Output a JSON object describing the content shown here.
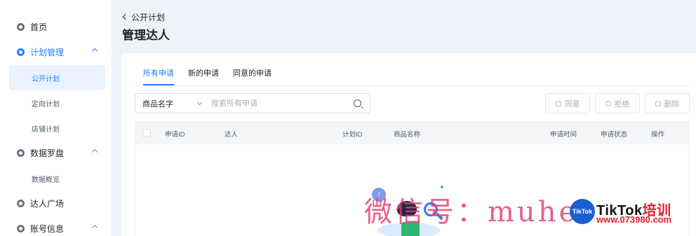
{
  "sidebar": {
    "home": "首页",
    "plan_management": {
      "label": "计划管理",
      "items": [
        "公开计划",
        "定向计划",
        "店铺计划"
      ],
      "selected": "公开计划"
    },
    "data_compass": {
      "label": "数据罗盘",
      "items": [
        "数据概览"
      ]
    },
    "creator_plaza": "达人广场",
    "account_info": "账号信息"
  },
  "header": {
    "breadcrumb_back": "公开计划",
    "title": "管理达人"
  },
  "tabs": [
    "所有申请",
    "新的申请",
    "同意的申请"
  ],
  "active_tab": "所有申请",
  "search": {
    "select_value": "商品名字",
    "placeholder": "搜索所有申请"
  },
  "actions": {
    "approve": "同意",
    "reject": "拒绝",
    "delete": "删除"
  },
  "table": {
    "columns": [
      "申请ID",
      "达人",
      "计划ID",
      "商品名称",
      "申请时间",
      "申请状态",
      "操作"
    ]
  },
  "watermark": {
    "text": "微信号：muhe",
    "logo_text": "TikTok",
    "brand": "TikTok",
    "brand_suffix": "培训",
    "url": "www.073980.com"
  },
  "colors": {
    "accent": "#1e80ff",
    "background": "#eef2f9",
    "watermark": "#e63c6e",
    "brand_red": "#e2202d"
  }
}
